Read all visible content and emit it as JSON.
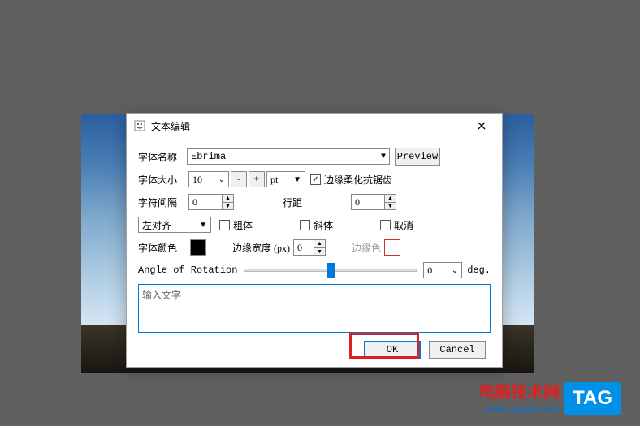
{
  "dialog": {
    "title": "文本编辑",
    "labels": {
      "font_name": "字体名称",
      "font_size": "字体大小",
      "char_spacing": "字符间隔",
      "bold": "粗体",
      "italic": "斜体",
      "strike": "取消",
      "font_color": "字体颜色",
      "border_width": "边缘宽度 (px)",
      "border_color": "边缘色",
      "angle": "Angle of Rotation",
      "line_spacing": "行距",
      "antialias": "边缘柔化抗锯齿",
      "deg": "deg."
    },
    "values": {
      "font_name": "Ebrima",
      "font_size": "10",
      "unit": "pt",
      "char_spacing": "0",
      "line_spacing": "0",
      "align": "左对齐",
      "border_width": "0",
      "angle": "0",
      "textarea_placeholder": "输入文字",
      "font_color": "#000000",
      "border_color": "#ffffff",
      "antialias_checked": true
    },
    "buttons": {
      "preview": "Preview",
      "minus": "-",
      "plus": "+",
      "ok": "OK",
      "cancel": "Cancel"
    }
  },
  "watermark": {
    "cn": "电脑技术网",
    "url": "www.tagxp.com",
    "tag": "TAG"
  }
}
